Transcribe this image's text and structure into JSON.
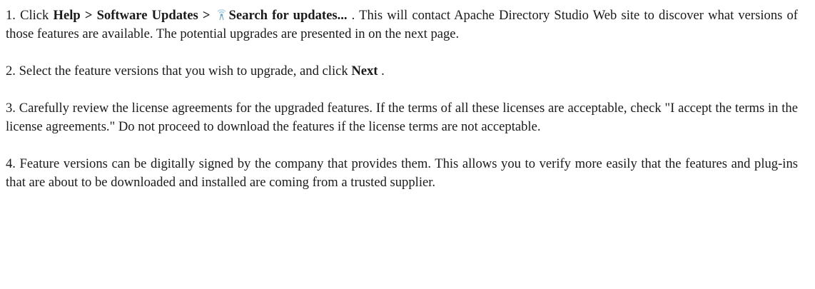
{
  "steps": [
    {
      "prefix": "1. Click ",
      "menu_help": "Help",
      "sep1": " > ",
      "menu_software_updates": "Software Updates",
      "sep2": " > ",
      "icon": "search-updates-icon",
      "menu_search": "Search for updates...",
      "rest": " . This will contact Apache Directory Studio Web site to discover what versions of those features are available. The potential upgrades are presented in on the next page."
    },
    {
      "prefix": "2. Select the feature versions that you wish to upgrade, and click ",
      "button_next": "Next",
      "rest": " ."
    },
    {
      "text": "3. Carefully review the license agreements for the upgraded features. If the terms of all these licenses are acceptable, check \"I accept the terms in the license agreements.\" Do not proceed to download the features if the license terms are not acceptable."
    },
    {
      "text": "4. Feature versions can be digitally signed by the company that provides them. This allows you to verify more easily that the features and plug-ins that are about to be downloaded and installed are coming from a trusted supplier."
    }
  ],
  "colors": {
    "text": "#1a1a1a",
    "icon_accent": "#6aa7c8"
  }
}
